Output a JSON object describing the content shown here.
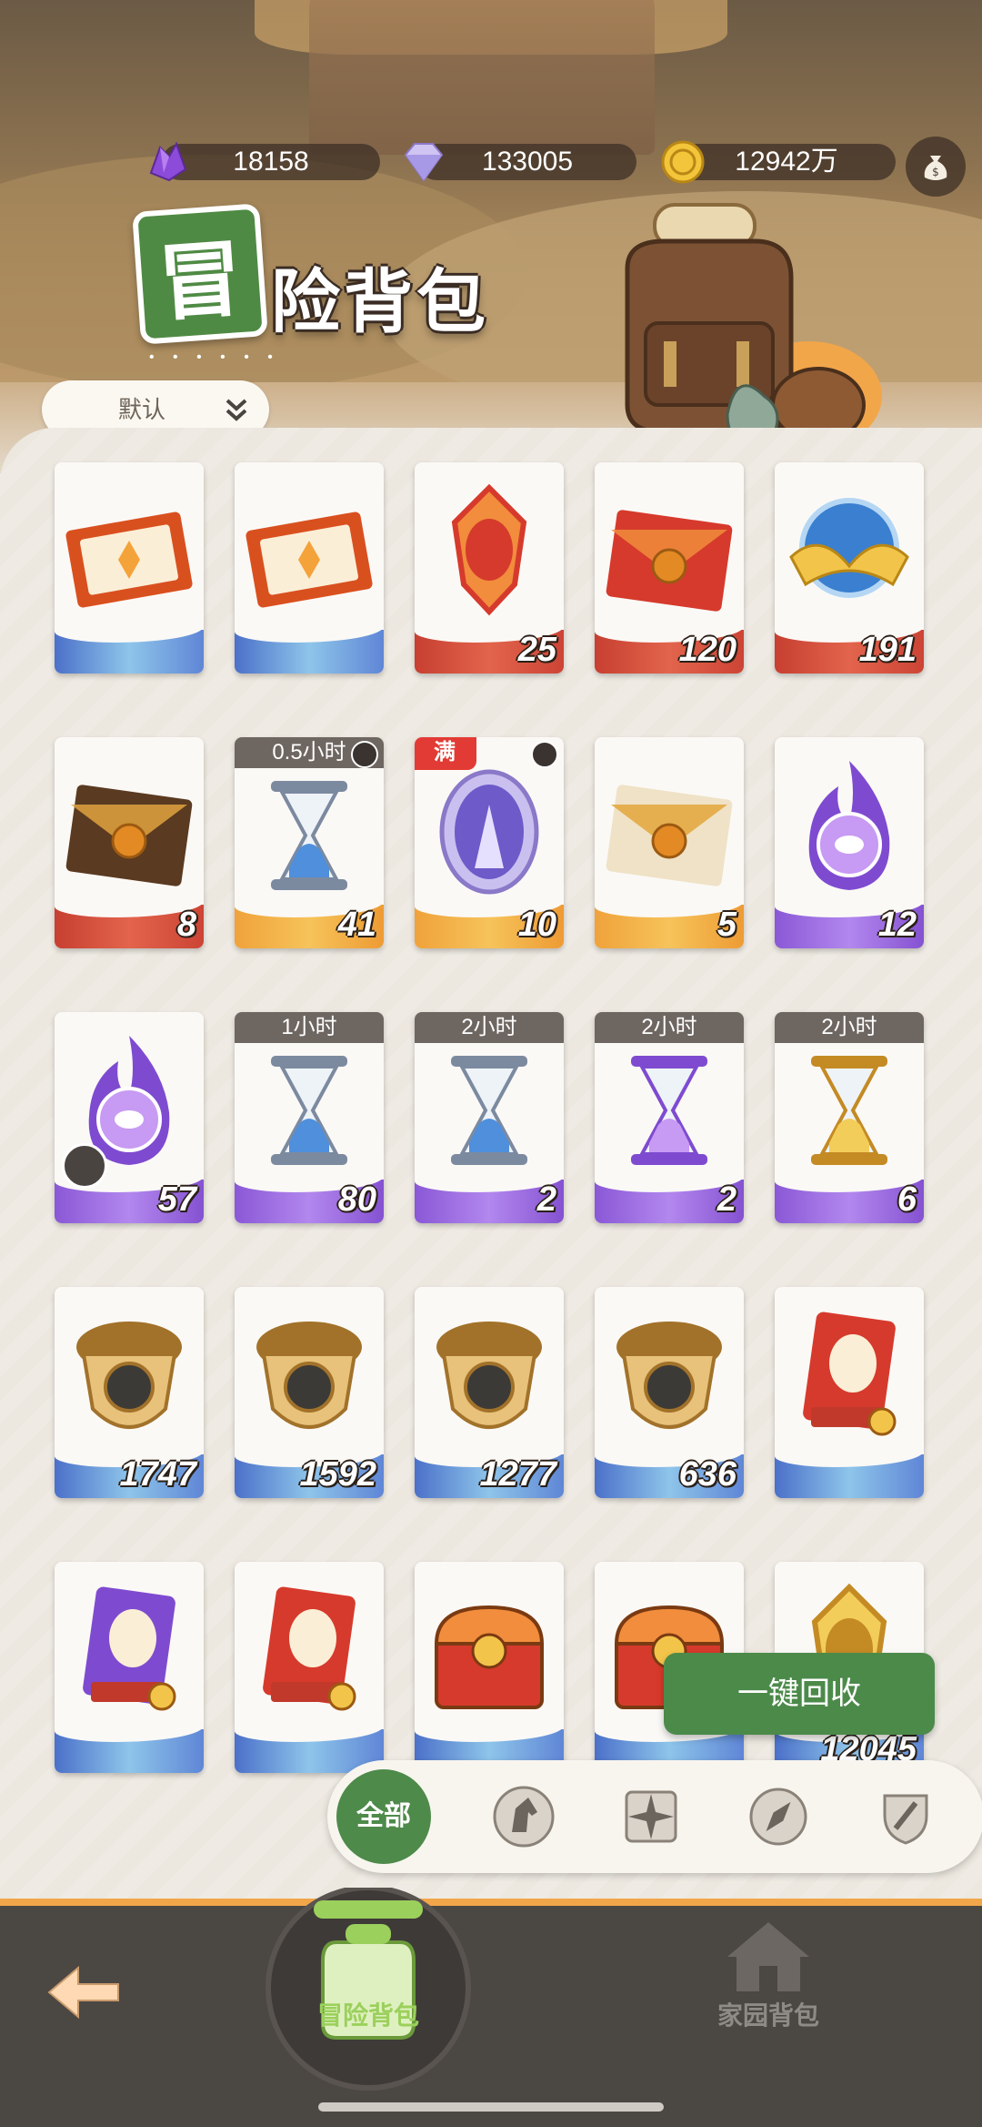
{
  "currency": [
    {
      "icon": "purple-crystal-icon",
      "amount": "18158"
    },
    {
      "icon": "diamond-icon",
      "amount": "133005"
    },
    {
      "icon": "gold-coin-icon",
      "amount": "12942万"
    }
  ],
  "header": {
    "title_first": "冒",
    "title_rest": "险背包",
    "dots": "• • • • • •"
  },
  "sort": {
    "label": "默认"
  },
  "items": [
    {
      "name": "ticket-orange",
      "count": "",
      "band": "blue"
    },
    {
      "name": "ticket-pink",
      "count": "",
      "band": "blue"
    },
    {
      "name": "red-medal",
      "count": "25",
      "band": "red"
    },
    {
      "name": "red-envelope-letter",
      "count": "120",
      "band": "red"
    },
    {
      "name": "blue-orb-wings",
      "count": "191",
      "band": "red"
    },
    {
      "name": "dark-envelope",
      "count": "8",
      "band": "red"
    },
    {
      "name": "hourglass-blue",
      "count": "41",
      "band": "orange",
      "timer": "0.5小时"
    },
    {
      "name": "portrait-egg",
      "count": "10",
      "band": "orange",
      "full": "满"
    },
    {
      "name": "white-envelope",
      "count": "5",
      "band": "orange"
    },
    {
      "name": "purple-flame-eye",
      "count": "12",
      "band": "purple"
    },
    {
      "name": "purple-flame-trident",
      "count": "57",
      "band": "purple",
      "puzzle": true
    },
    {
      "name": "hourglass-blue-1h",
      "count": "80",
      "band": "purple",
      "timer": "1小时"
    },
    {
      "name": "hourglass-blue-2h",
      "count": "2",
      "band": "purple",
      "timer": "2小时"
    },
    {
      "name": "hourglass-purple-2h",
      "count": "2",
      "band": "purple",
      "timer": "2小时"
    },
    {
      "name": "hourglass-gold-2h",
      "count": "6",
      "band": "purple",
      "timer": "2小时"
    },
    {
      "name": "acorn-green-eye",
      "count": "1747",
      "band": "blue"
    },
    {
      "name": "acorn-orange-target",
      "count": "1592",
      "band": "blue"
    },
    {
      "name": "acorn-green-leaf",
      "count": "1277",
      "band": "blue"
    },
    {
      "name": "acorn-blue-star",
      "count": "636",
      "band": "blue"
    },
    {
      "name": "orange-card",
      "count": "",
      "band": "blue"
    },
    {
      "name": "purple-card",
      "count": "",
      "band": "blue"
    },
    {
      "name": "orange-card-anchor",
      "count": "",
      "band": "blue"
    },
    {
      "name": "treasure-chest-red",
      "count": "",
      "band": "blue"
    },
    {
      "name": "treasure-chest-red-2",
      "count": "",
      "band": "blue"
    },
    {
      "name": "gold-item",
      "count": "12045",
      "band": "blue"
    }
  ],
  "actions": {
    "recycle_label": "一键回收"
  },
  "filters": {
    "all_label": "全部",
    "icons": [
      "horse-head-icon",
      "shuriken-icon",
      "compass-icon",
      "sword-shield-icon"
    ]
  },
  "nav": {
    "adventure_label": "冒险背包",
    "home_label": "家园背包"
  },
  "colors": {
    "accent_green": "#4e8a4a",
    "nav_bg": "#4b4743",
    "nav_border": "#f2a64a"
  }
}
